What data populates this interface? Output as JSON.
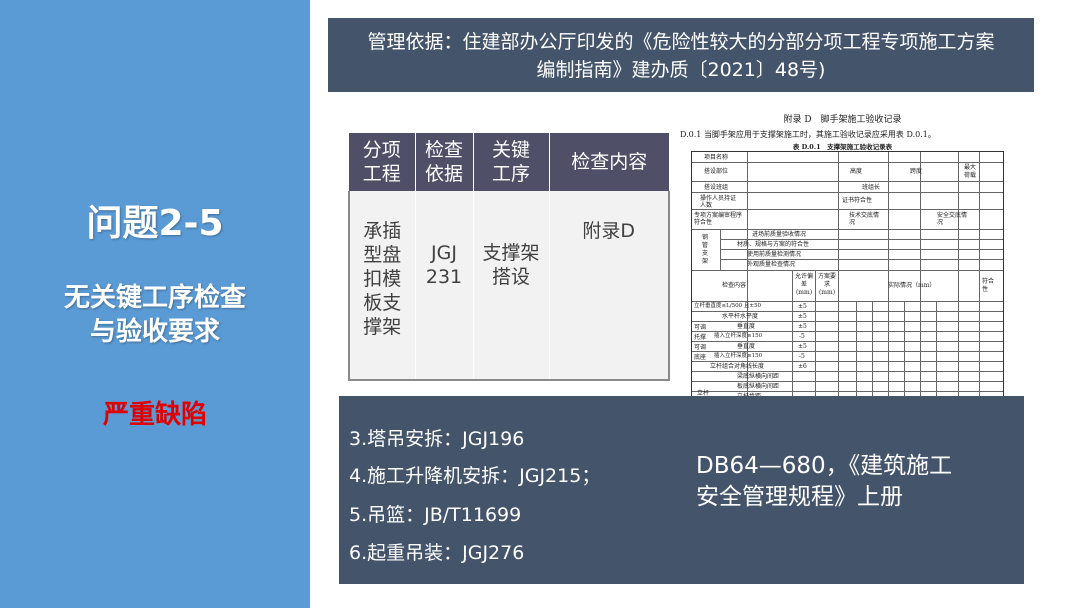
{
  "sidebar": {
    "issue_number": "问题2-5",
    "issue_title_line1": "无关键工序检查",
    "issue_title_line2": "与验收要求",
    "severity": "严重缺陷"
  },
  "header": {
    "line1": "管理依据：住建部办公厅印发的《危险性较大的分部分项工程专项施工方案",
    "line2": "编制指南》建办质〔2021〕48号)"
  },
  "inspection_table": {
    "columns": [
      [
        "分项",
        "工程"
      ],
      [
        "检查",
        "依据"
      ],
      [
        "关键",
        "工序"
      ],
      [
        "检查内容"
      ]
    ],
    "row": [
      [
        "承插",
        "型盘",
        "扣模",
        "板支",
        "撑架"
      ],
      [
        "JGJ",
        "231"
      ],
      [
        "支撑架",
        "搭设"
      ],
      [
        "附录D"
      ]
    ]
  },
  "appendix": {
    "title": "附录 D　脚手架施工验收记录",
    "note": "D.0.1  当脚手架应用于支撑架施工时，其施工验收记录应采用表 D.0.1。",
    "caption": "表 D.0.1　支撑架施工验收记录表",
    "labels": {
      "project_name": "项目名称",
      "location": "搭设部位",
      "height": "高度",
      "span": "跨度",
      "max_load": "最大荷载",
      "team": "搭设班组",
      "team_leader": "班组长",
      "operators": "操作人员持证人数",
      "certificate": "证书符合性",
      "plan_compliance": "专项方案编审程序符合性",
      "tech_briefing": "技术交底情况",
      "safety_briefing": "安全交底情况",
      "steel_tube": "钢管支架",
      "check_entry": "进场前质量验收情况",
      "check_material": "材质、规格与方案的符合性",
      "check_use": "使用前质量检测情况",
      "check_appearance": "外观质量检查情况",
      "inspect_item": "检查内容",
      "allowable": "允许偏差(mm)",
      "plan_req": "方案要求(mm)",
      "actual": "实际情况（mm）",
      "conform": "符合性",
      "r1": "立杆垂直度≤L/500 且±50",
      "r2": "水平杆水平度",
      "r3a": "可调托撑",
      "r3": "垂直度",
      "r4": "插入立杆深度≥150",
      "r5a": "可调底座",
      "r5": "垂直度",
      "r6": "插入立杆深度≥150",
      "r7": "立杆组合对角线长度",
      "r8": "梁底纵横向间距",
      "r9": "板底纵横向间距",
      "r10a": "立杆",
      "r10": "立杆步距",
      "v1": "±5",
      "v2": "±5",
      "v3": "±5",
      "v4": "-5",
      "v5": "±5",
      "v6": "-5",
      "v7": "±6"
    }
  },
  "standards": {
    "items": [
      "3.塔吊安拆：JGJ196",
      "4.施工升降机安拆：JGJ215；",
      "5.吊篮：JB/T11699",
      "6.起重吊装：JGJ276"
    ],
    "db_line1": "DB64—680，《建筑施工",
    "db_line2": "安全管理规程》上册"
  },
  "colors": {
    "sidebar_bg": "#5b9bd5",
    "header_bg": "#44546a",
    "table_header_bg": "#4f4f67",
    "severity": "#e00000"
  }
}
